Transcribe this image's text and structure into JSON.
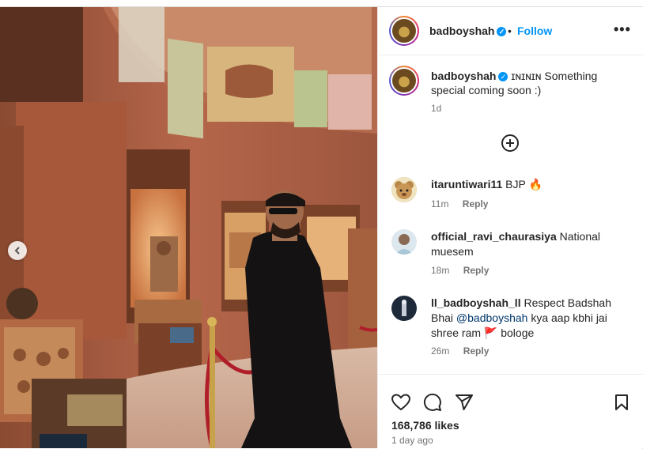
{
  "post": {
    "username": "badboyshah",
    "follow_label": "Follow",
    "dot": "•",
    "more_label": "•••"
  },
  "caption": {
    "username": "badboyshah",
    "text": "ɪɴɪɴɪɴ Something special coming soon :)",
    "age": "1d"
  },
  "comments": [
    {
      "username": "itaruntiwari11",
      "text": "BJP 🔥",
      "age": "11m",
      "reply_label": "Reply"
    },
    {
      "username": "official_ravi_chaurasiya",
      "text": "National muesem",
      "age": "18m",
      "reply_label": "Reply"
    },
    {
      "username": "ll_badboyshah_ll",
      "text_before": "Respect Badshah Bhai ",
      "mention": "@badboyshah",
      "text_after": " kya aap kbhi jai shree ram 🚩 bologe",
      "age": "26m",
      "reply_label": "Reply"
    }
  ],
  "footer": {
    "likes": "168,786 likes",
    "posted": "1 day ago"
  },
  "icons": [
    "heart-icon",
    "comment-icon",
    "share-icon",
    "bookmark-icon",
    "chevron-left-icon",
    "add-circle-icon",
    "more-icon",
    "verified-icon"
  ],
  "colors": {
    "accent": "#0095f6",
    "text": "#262626",
    "muted": "#737373",
    "mention": "#00376b"
  }
}
